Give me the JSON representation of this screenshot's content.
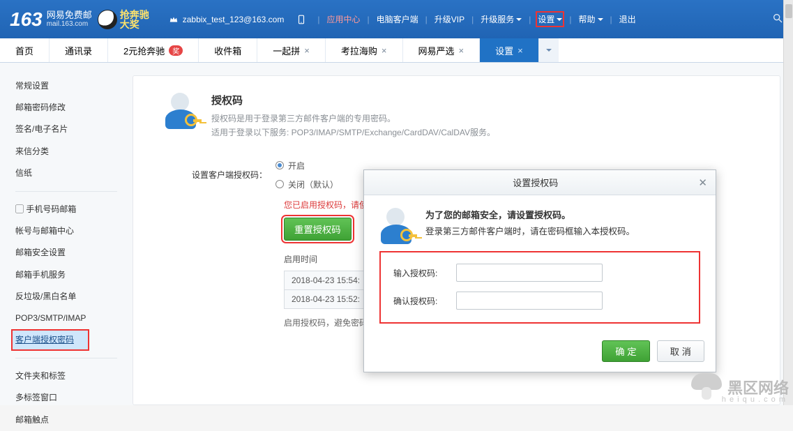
{
  "site": {
    "brand": "163",
    "cn": "网易免费邮",
    "en": "mail.163.com"
  },
  "promo": {
    "line1": "抢奔驰",
    "line2": "大奖"
  },
  "account": "zabbix_test_123@163.com",
  "topnav": {
    "app": "应用中心",
    "client": "电脑客户端",
    "vip": "升级VIP",
    "upgrade": "升级服务",
    "settings": "设置",
    "help": "帮助",
    "logout": "退出"
  },
  "tabs": [
    {
      "label": "首页",
      "closable": false
    },
    {
      "label": "通讯录",
      "closable": false
    },
    {
      "label": "2元抢奔驰",
      "closable": false,
      "badge": "奖"
    },
    {
      "label": "收件箱",
      "closable": false
    },
    {
      "label": "一起拼",
      "closable": true
    },
    {
      "label": "考拉海购",
      "closable": true
    },
    {
      "label": "网易严选",
      "closable": true
    },
    {
      "label": "设置",
      "closable": true,
      "active": true
    }
  ],
  "sidebar": {
    "group1": [
      "常规设置",
      "邮箱密码修改",
      "签名/电子名片",
      "来信分类",
      "信纸"
    ],
    "group2": [
      "手机号码邮箱",
      "帐号与邮箱中心",
      "邮箱安全设置",
      "邮箱手机服务",
      "反垃圾/黑白名单",
      "POP3/SMTP/IMAP",
      "客户端授权密码"
    ],
    "group3": [
      "文件夹和标签",
      "多标签窗口",
      "邮箱触点"
    ]
  },
  "content": {
    "title": "授权码",
    "desc1": "授权码是用于登录第三方邮件客户端的专用密码。",
    "desc2": "适用于登录以下服务: POP3/IMAP/SMTP/Exchange/CardDAV/CalDAV服务。",
    "set_label": "设置客户端授权码：",
    "radio_on": "开启",
    "radio_off": "关闭（默认）",
    "enabled_msg": "您已启用授权码，请使",
    "reset_btn": "重置授权码",
    "enable_time": "启用时间",
    "times": [
      "2018-04-23 15:54:",
      "2018-04-23 15:52:"
    ],
    "enable_note": "启用授权码，避免密码"
  },
  "modal": {
    "title": "设置授权码",
    "h1": "为了您的邮箱安全，请设置授权码。",
    "h2": "登录第三方邮件客户端时，请在密码框输入本授权码。",
    "lbl1": "输入授权码:",
    "lbl2": "确认授权码:",
    "ok": "确 定",
    "cancel": "取 消"
  },
  "watermark": {
    "text": "黑区网络",
    "url": "h e i q u . c o m"
  }
}
